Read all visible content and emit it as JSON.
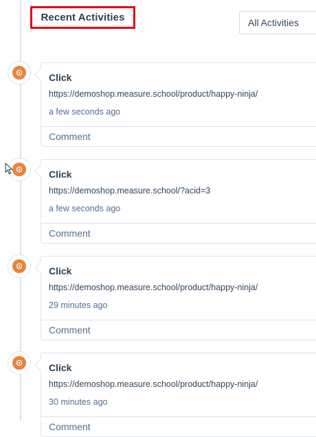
{
  "header": {
    "title": "Recent Activities",
    "filter_selected": "All Activities"
  },
  "activities": [
    {
      "type": "Click",
      "url": "https://demoshop.measure.school/product/happy-ninja/",
      "time": "a few seconds ago",
      "comment_label": "Comment"
    },
    {
      "type": "Click",
      "url": "https://demoshop.measure.school/?acid=3",
      "time": "a few seconds ago",
      "comment_label": "Comment"
    },
    {
      "type": "Click",
      "url": "https://demoshop.measure.school/product/happy-ninja/",
      "time": "29 minutes ago",
      "comment_label": "Comment"
    },
    {
      "type": "Click",
      "url": "https://demoshop.measure.school/product/happy-ninja/",
      "time": "30 minutes ago",
      "comment_label": "Comment"
    }
  ],
  "icons": {
    "activity": "target-icon",
    "pointer": "mouse-cursor-icon"
  },
  "colors": {
    "highlight_border": "#e3001b",
    "activity_icon": "#e8843b",
    "border": "#dfe3eb",
    "text": "#33475b"
  }
}
